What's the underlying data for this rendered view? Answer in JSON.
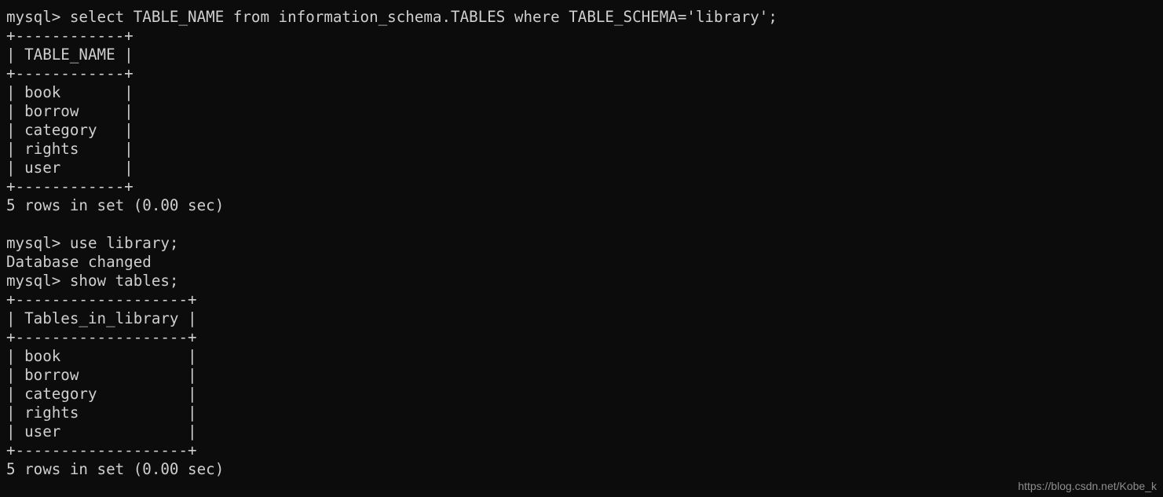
{
  "terminal": {
    "background_color": "#0c0c0c",
    "text_color": "#cfcfcf",
    "prompt": "mysql>",
    "lines": [
      "mysql> select TABLE_NAME from information_schema.TABLES where TABLE_SCHEMA='library';",
      "+------------+",
      "| TABLE_NAME |",
      "+------------+",
      "| book       |",
      "| borrow     |",
      "| category   |",
      "| rights     |",
      "| user       |",
      "+------------+",
      "5 rows in set (0.00 sec)",
      "",
      "mysql> use library;",
      "Database changed",
      "mysql> show tables;",
      "+-------------------+",
      "| Tables_in_library |",
      "+-------------------+",
      "| book              |",
      "| borrow            |",
      "| category          |",
      "| rights            |",
      "| user              |",
      "+-------------------+",
      "5 rows in set (0.00 sec)"
    ],
    "text": "mysql> select TABLE_NAME from information_schema.TABLES where TABLE_SCHEMA='library';\n+------------+\n| TABLE_NAME |\n+------------+\n| book       |\n| borrow     |\n| category   |\n| rights     |\n| user       |\n+------------+\n5 rows in set (0.00 sec)\n\nmysql> use library;\nDatabase changed\nmysql> show tables;\n+-------------------+\n| Tables_in_library |\n+-------------------+\n| book              |\n| borrow            |\n| category          |\n| rights            |\n| user              |\n+-------------------+\n5 rows in set (0.00 sec)",
    "commands": [
      "select TABLE_NAME from information_schema.TABLES where TABLE_SCHEMA='library';",
      "use library;",
      "show tables;"
    ],
    "status_messages": [
      "5 rows in set (0.00 sec)",
      "Database changed",
      "5 rows in set (0.00 sec)"
    ],
    "result_tables": [
      {
        "header": "TABLE_NAME",
        "rows": [
          "book",
          "borrow",
          "category",
          "rights",
          "user"
        ],
        "row_count_text": "5 rows in set (0.00 sec)"
      },
      {
        "header": "Tables_in_library",
        "rows": [
          "book",
          "borrow",
          "category",
          "rights",
          "user"
        ],
        "row_count_text": "5 rows in set (0.00 sec)"
      }
    ]
  },
  "watermark": {
    "text": "https://blog.csdn.net/Kobe_k",
    "color": "#8e8e8e"
  }
}
